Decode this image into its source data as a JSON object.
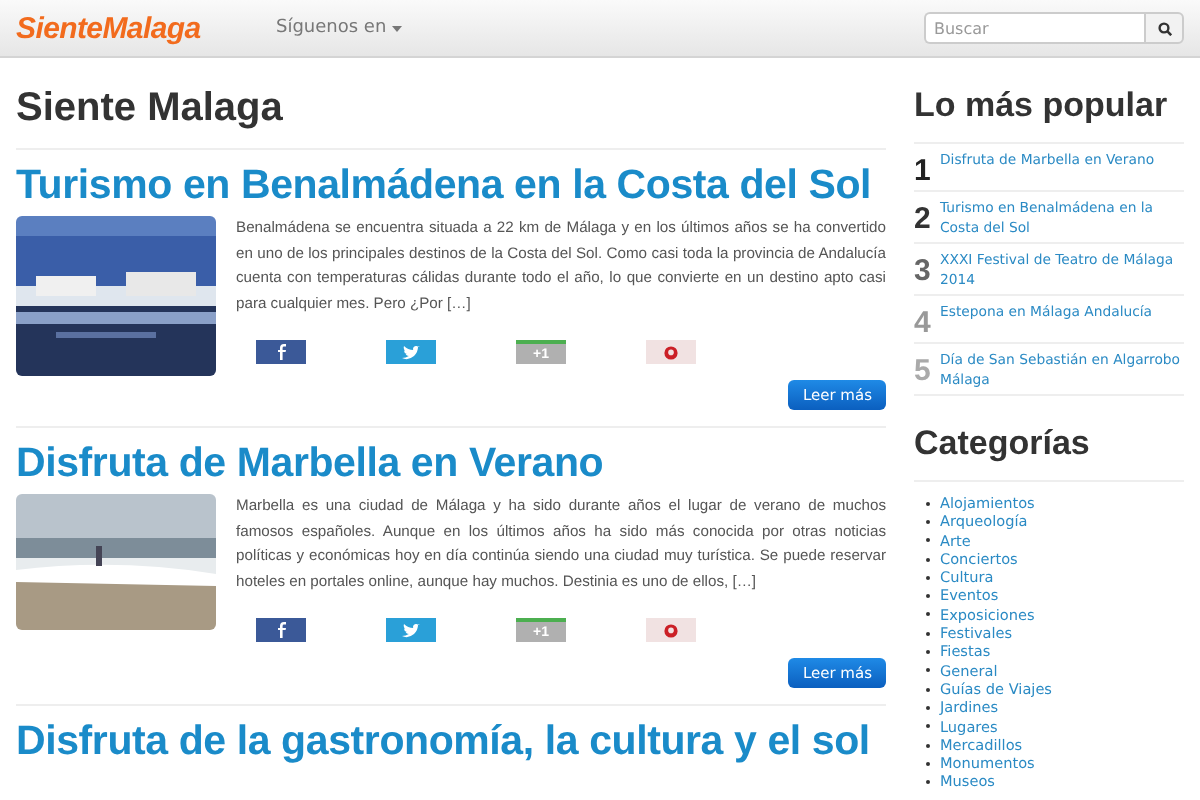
{
  "navbar": {
    "logo": "SienteMalaga",
    "menu": "Síguenos en",
    "search": {
      "placeholder": "Buscar"
    }
  },
  "page_title": "Siente Malaga",
  "articles": [
    {
      "title": "Turismo en Benalmádena en la Costa del Sol",
      "excerpt": "Benalmádena se encuentra situada a 22 km de Málaga y en los últimos años se ha convertido en uno de los principales destinos de la Costa del Sol.  Como casi toda la provincia de Andalucía cuenta con temperaturas cálidas durante todo el año, lo que convierte en un destino apto casi para cualquier mes. Pero ¿Por […]",
      "share": [
        {
          "kind": "facebook"
        },
        {
          "kind": "twitter"
        },
        {
          "kind": "gplus",
          "label": "+1"
        },
        {
          "kind": "pinterest"
        }
      ],
      "button": "Leer más"
    },
    {
      "title": "Disfruta de Marbella en Verano",
      "excerpt": "Marbella es una ciudad de Málaga y ha sido durante años el lugar de verano de muchos famosos españoles. Aunque en los últimos años ha sido más conocida por otras noticias políticas y económicas hoy en día continúa siendo una ciudad muy turística. Se puede reservar hoteles en portales online, aunque hay muchos. Destinia es uno de ellos, […]",
      "share": [
        {
          "kind": "facebook"
        },
        {
          "kind": "twitter"
        },
        {
          "kind": "gplus",
          "label": "+1"
        },
        {
          "kind": "pinterest"
        }
      ],
      "button": "Leer más"
    },
    {
      "title": "Disfruta de la gastronomía, la cultura y el sol"
    }
  ],
  "sidebar": {
    "popular_title": "Lo más popular",
    "popular": [
      {
        "rank": "1",
        "title": "Disfruta de Marbella en Verano"
      },
      {
        "rank": "2",
        "title": "Turismo en Benalmádena en la Costa del Sol"
      },
      {
        "rank": "3",
        "title": "XXXI Festival de Teatro de Málaga 2014"
      },
      {
        "rank": "4",
        "title": "Estepona en Málaga Andalucía"
      },
      {
        "rank": "5",
        "title": "Día de San Sebastián en Algarrobo Málaga"
      }
    ],
    "categories_title": "Categorías",
    "categories": [
      "Alojamientos",
      "Arqueología",
      "Arte",
      "Conciertos",
      "Cultura",
      "Eventos",
      "Exposiciones",
      "Festivales",
      "Fiestas",
      "General",
      "Guías de Viajes",
      "Jardines",
      "Lugares",
      "Mercadillos",
      "Monumentos",
      "Museos"
    ]
  }
}
